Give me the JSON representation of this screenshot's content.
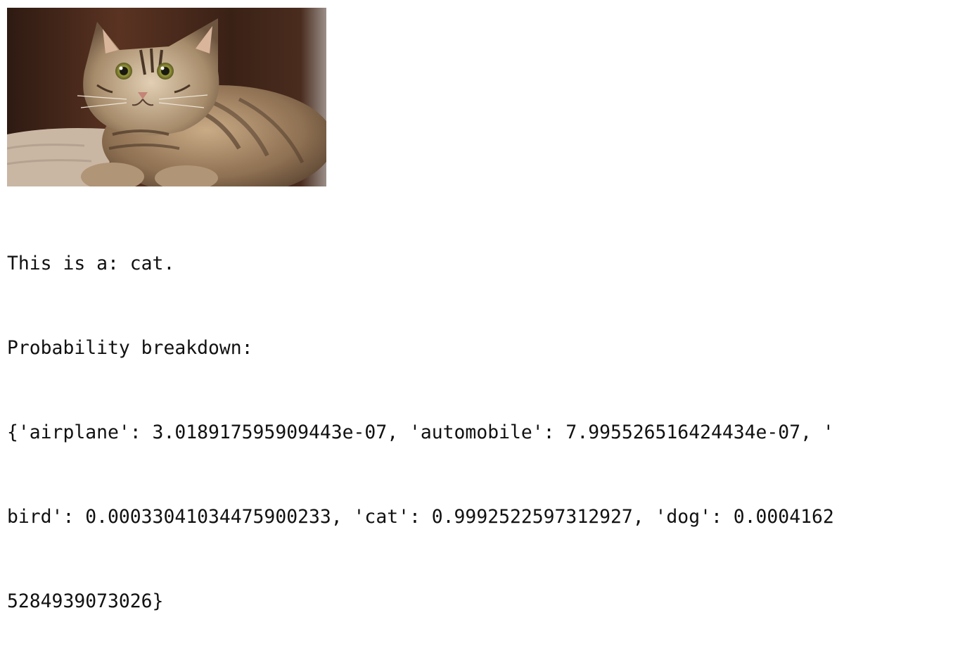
{
  "image": {
    "subject": "cat-photo"
  },
  "output": {
    "prediction_line": "This is a: cat.",
    "breakdown_header": "Probability breakdown:",
    "breakdown_lines": [
      "{'airplane': 3.018917595909443e-07, 'automobile': 7.995526516424434e-07, '",
      "bird': 0.00033041034475900233, 'cat': 0.9992522597312927, 'dog': 0.0004162",
      "5284939073026}"
    ]
  },
  "probabilities": {
    "airplane": "3.018917595909443e-07",
    "automobile": "7.995526516424434e-07",
    "bird": "0.00033041034475900233",
    "cat": "0.9992522597312927",
    "dog": "0.00041625284939073026"
  }
}
